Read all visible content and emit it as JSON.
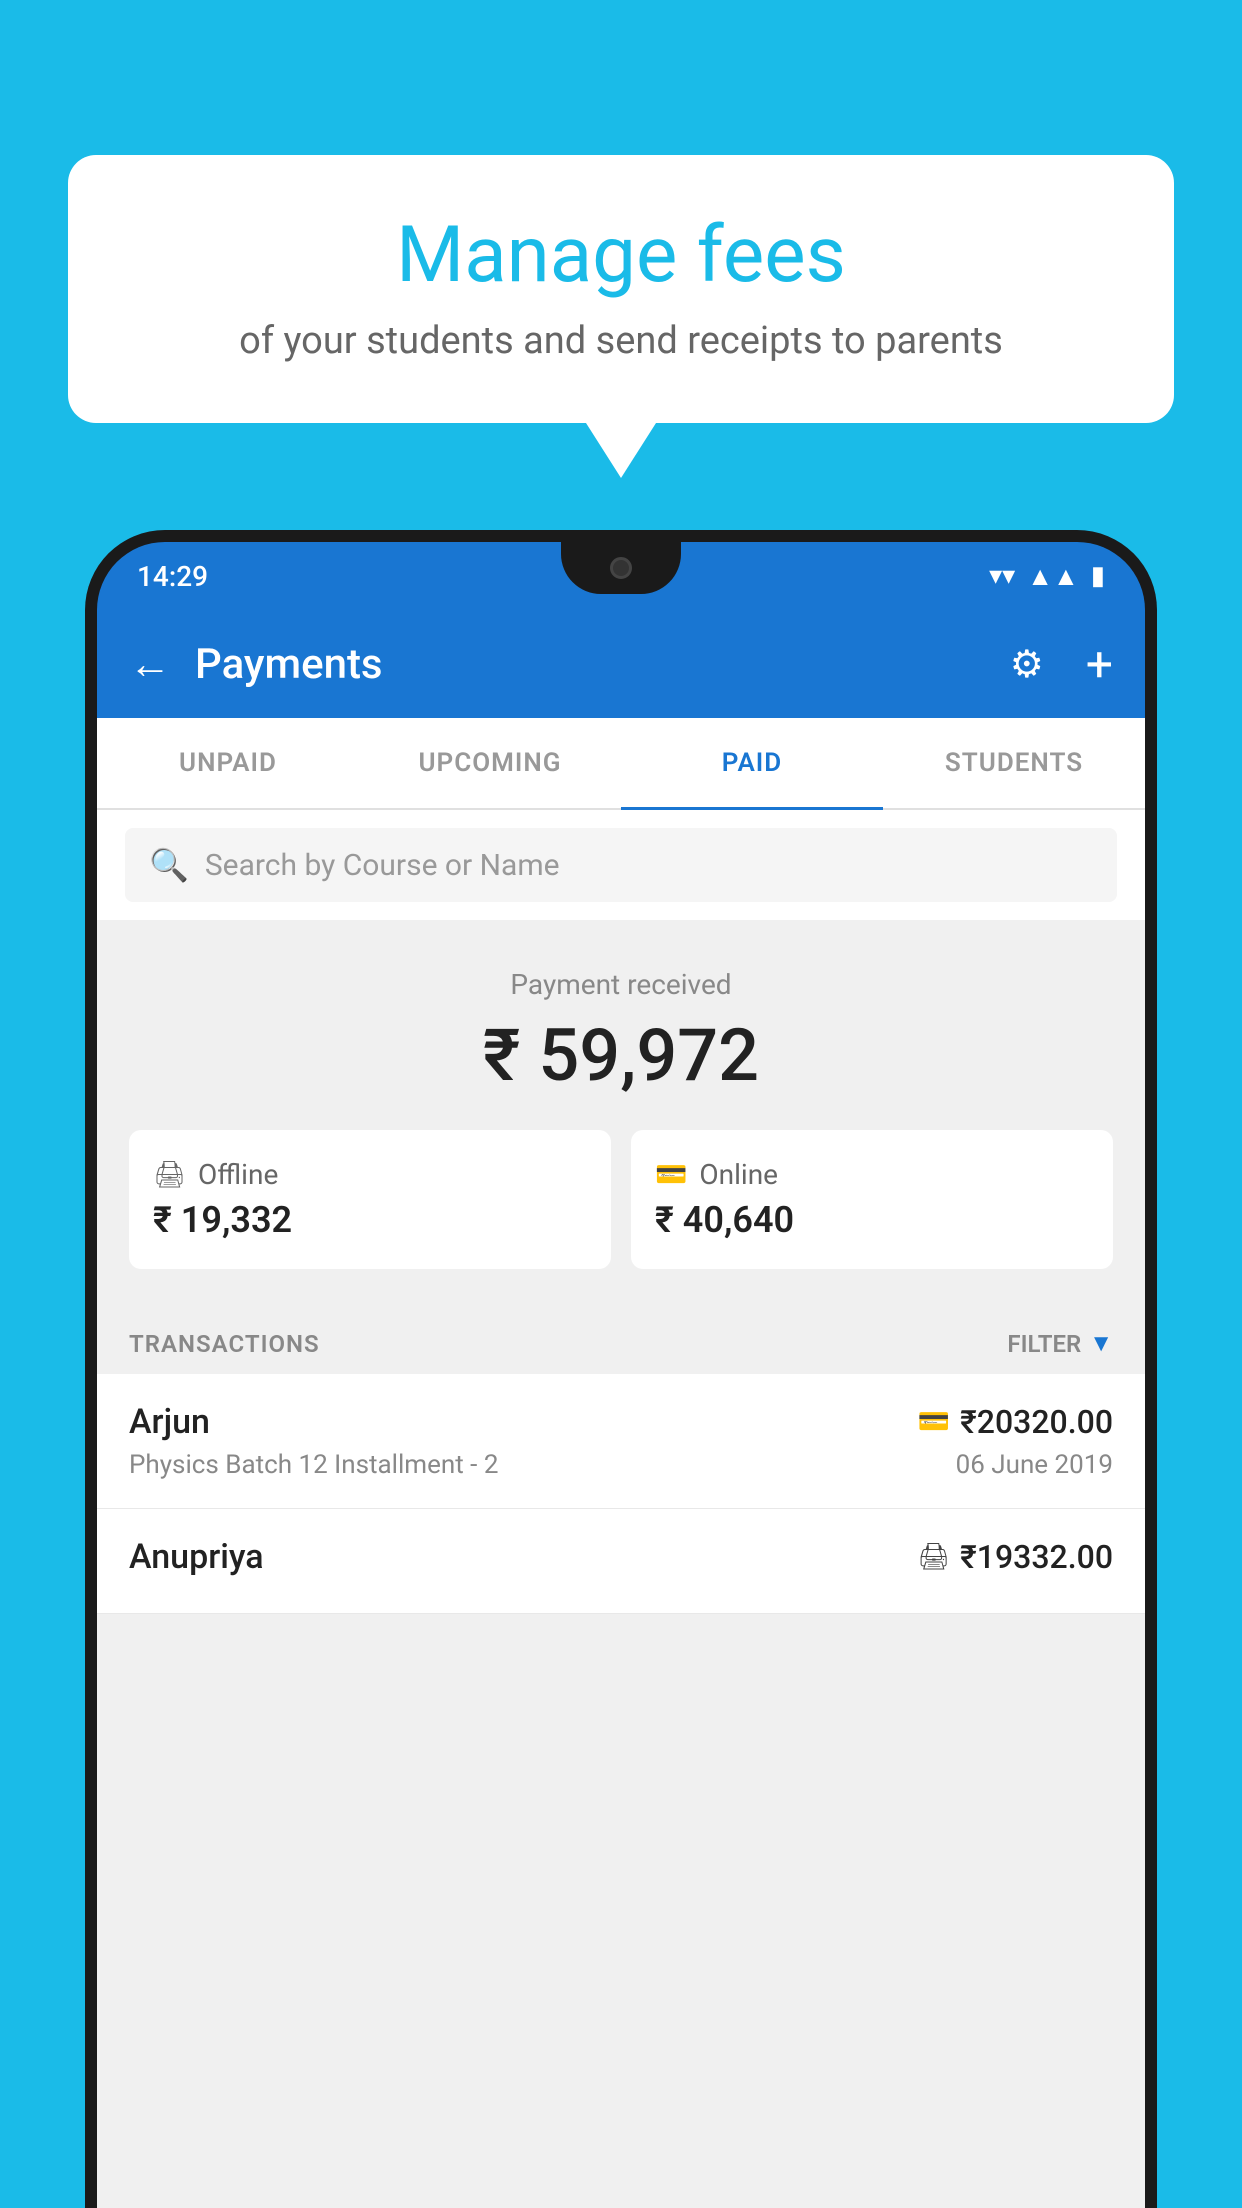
{
  "background_color": "#1ABBE8",
  "speech_bubble": {
    "title": "Manage fees",
    "subtitle": "of your students and send receipts to parents"
  },
  "status_bar": {
    "time": "14:29",
    "wifi_icon": "▼",
    "signal_icon": "▲",
    "battery_icon": "▮"
  },
  "header": {
    "title": "Payments",
    "back_label": "←",
    "settings_label": "⚙",
    "add_label": "+"
  },
  "tabs": [
    {
      "label": "UNPAID",
      "active": false
    },
    {
      "label": "UPCOMING",
      "active": false
    },
    {
      "label": "PAID",
      "active": true
    },
    {
      "label": "STUDENTS",
      "active": false
    }
  ],
  "search": {
    "placeholder": "Search by Course or Name"
  },
  "payment_summary": {
    "received_label": "Payment received",
    "total_amount": "₹ 59,972",
    "offline": {
      "label": "Offline",
      "amount": "₹ 19,332"
    },
    "online": {
      "label": "Online",
      "amount": "₹ 40,640"
    }
  },
  "transactions": {
    "label": "TRANSACTIONS",
    "filter_label": "FILTER",
    "items": [
      {
        "name": "Arjun",
        "description": "Physics Batch 12 Installment - 2",
        "amount": "₹20320.00",
        "date": "06 June 2019",
        "payment_type": "online"
      },
      {
        "name": "Anupriya",
        "description": "",
        "amount": "₹19332.00",
        "date": "",
        "payment_type": "offline"
      }
    ]
  }
}
